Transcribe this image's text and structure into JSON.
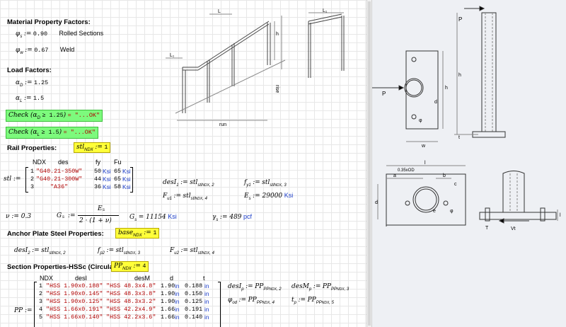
{
  "worksheet": {
    "material_heading": "Material Property Factors:",
    "phi_s": {
      "sym": "φ",
      "sub": "s",
      "assign": ":=",
      "val": "0.90",
      "desc": "Rolled Sections"
    },
    "phi_w": {
      "sym": "φ",
      "sub": "w",
      "assign": ":=",
      "val": "0.67",
      "desc": "Weld"
    },
    "load_heading": "Load Factors:",
    "alpha_d": {
      "sym": "α",
      "sub": "D",
      "assign": ":=",
      "val": "1.25"
    },
    "alpha_l": {
      "sym": "α",
      "sub": "L",
      "assign": ":=",
      "val": "1.5"
    },
    "check1": {
      "fn": "Check",
      "expr": "α",
      "sub": "D",
      "cond": "≥ 1.25",
      "result": "= \"...OK\""
    },
    "check2": {
      "fn": "Check",
      "expr": "α",
      "sub": "L",
      "cond": "≥ 1.5",
      "result": "= \"...OK\""
    },
    "rail_heading": "Rail Properties:",
    "rail_sel": {
      "sym": "stl",
      "sub": "NDX",
      "assign": ":=",
      "val": "1"
    },
    "stl_headers": [
      "NDX",
      "des",
      "fy",
      "Fu"
    ],
    "stl_name": "stl :=",
    "stl_rows": [
      {
        "ndx": "1",
        "des": "\"G40.21-350W\"",
        "fy": "50",
        "fy_u": "Ksi",
        "fu": "65",
        "fu_u": "Ksi"
      },
      {
        "ndx": "2",
        "des": "\"G40.21-300W\"",
        "fy": "44",
        "fy_u": "Ksi",
        "fu": "65",
        "fu_u": "Ksi"
      },
      {
        "ndx": "3",
        "des": "\"A36\"",
        "fy": "36",
        "fy_u": "Ksi",
        "fu": "58",
        "fu_u": "Ksi"
      }
    ],
    "desI1": {
      "lhs": "desI",
      "lsub": "1",
      "rhs": "stl",
      "rsub": "stl",
      "idx": "NDX",
      "col": "2"
    },
    "fy1": {
      "lhs": "f",
      "lsub": "y1",
      "rhs": "stl",
      "rsub": "stl",
      "idx": "NDX",
      "col": "3"
    },
    "Fu1": {
      "lhs": "F",
      "lsub": "u1",
      "rhs": "stl",
      "rsub": "stl",
      "idx": "NDX",
      "col": "4"
    },
    "Es": {
      "lhs": "E",
      "lsub": "s",
      "eq": ":= 29000",
      "unit": "Ksi"
    },
    "nu": {
      "text": "ν := 0.3"
    },
    "Gs_def": {
      "lhs": "G",
      "lsub": "s",
      "assign": ":=",
      "num": "E",
      "num_sub": "s",
      "den": "2 · (1 + ν)"
    },
    "Gs_val": {
      "lhs": "G",
      "lsub": "s",
      "eq": "= 11154",
      "unit": "Ksi"
    },
    "gamma_s": {
      "lhs": "γ",
      "lsub": "s",
      "eq": ":= 489",
      "unit": "pcf"
    },
    "anchor_heading": "Anchor Plate Steel Properties:",
    "anchor_sel": {
      "sym": "base",
      "sub": "NDX",
      "assign": ":=",
      "val": "1"
    },
    "desI2": {
      "lhs": "desI",
      "lsub": "2",
      "rhs": "stl",
      "rsub": "stl",
      "idx": "NDX",
      "col": "2"
    },
    "fp2": {
      "lhs": "f",
      "lsub": "p2",
      "rhs": "stl",
      "rsub": "stl",
      "idx": "NDX",
      "col": "3"
    },
    "Fu2": {
      "lhs": "F",
      "lsub": "u2",
      "rhs": "stl",
      "rsub": "stl",
      "idx": "NDX",
      "col": "4"
    },
    "section_heading": "Section Properties-HSSc (Circular):",
    "section_sel": {
      "sym": "PP",
      "sub": "NDX",
      "assign": ":=",
      "val": "4"
    },
    "pp_headers": [
      "NDX",
      "desI",
      "desM",
      "d",
      "t"
    ],
    "pp_name": "PP :=",
    "pp_rows": [
      {
        "ndx": "1",
        "desi": "\"HSS 1.90x0.188\"",
        "desm": "\"HSS 48.3x4.8\"",
        "d": "1.90",
        "d_u": "in",
        "t": "0.188",
        "t_u": "in"
      },
      {
        "ndx": "2",
        "desi": "\"HSS 1.90x0.145\"",
        "desm": "\"HSS 48.3x3.8\"",
        "d": "1.90",
        "d_u": "in",
        "t": "0.150",
        "t_u": "in"
      },
      {
        "ndx": "3",
        "desi": "\"HSS 1.90x0.125\"",
        "desm": "\"HSS 48.3x3.2\"",
        "d": "1.90",
        "d_u": "in",
        "t": "0.125",
        "t_u": "in"
      },
      {
        "ndx": "4",
        "desi": "\"HSS 1.66x0.191\"",
        "desm": "\"HSS 42.2x4.9\"",
        "d": "1.66",
        "d_u": "in",
        "t": "0.191",
        "t_u": "in"
      },
      {
        "ndx": "5",
        "desi": "\"HSS 1.66x0.140\"",
        "desm": "\"HSS 42.2x3.6\"",
        "d": "1.66",
        "d_u": "in",
        "t": "0.140",
        "t_u": "in"
      }
    ],
    "desIp": {
      "lhs": "desI",
      "lsub": "p",
      "rhs": "PP",
      "rsub": "PP",
      "idx": "NDX",
      "col": "2"
    },
    "desMp": {
      "lhs": "desM",
      "lsub": "p",
      "rhs": "PP",
      "rsub": "PP",
      "idx": "NDX",
      "col": "3"
    },
    "phi_od": {
      "lhs": "φ",
      "lsub": "od",
      "rhs": "PP",
      "rsub": "PP",
      "idx": "NDX",
      "col": "4"
    },
    "tp": {
      "lhs": "t",
      "lsub": "p",
      "rhs": "PP",
      "rsub": "PP",
      "idx": "NDX",
      "col": "5"
    }
  },
  "rail_sketch": {
    "label_L": "L",
    "label_L1": "L₁",
    "label_h": "h",
    "label_rise": "rise",
    "label_run": "run",
    "label_L2": "L₁"
  },
  "right_panel": {
    "post_P": "P",
    "post_h": "h",
    "post_t": "t",
    "plate_P": "P",
    "plate_h": "h",
    "plate_d": "d",
    "plate_w": "w",
    "plate_phi": "φ",
    "bottom_l": "l",
    "bottom_d": "d",
    "bottom_a": "a",
    "bottom_b": "b",
    "bottom_c": "c",
    "bottom_035": "0.35xOD",
    "bottom_e": "e",
    "bottom_phi": "φ",
    "side_v": "Vt",
    "side_t": "T",
    "side_l": "l"
  }
}
